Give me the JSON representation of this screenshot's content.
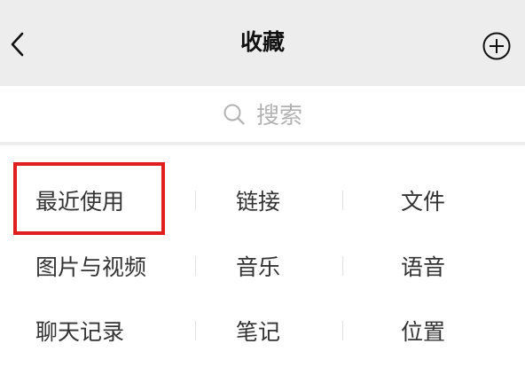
{
  "header": {
    "title": "收藏",
    "back_icon": "chevron-left-icon",
    "add_icon": "plus-circle-icon"
  },
  "search": {
    "placeholder": "搜索",
    "icon": "search-icon"
  },
  "categories": [
    {
      "label": "最近使用",
      "highlighted": true
    },
    {
      "label": "链接"
    },
    {
      "label": "文件"
    },
    {
      "label": "图片与视频"
    },
    {
      "label": "音乐"
    },
    {
      "label": "语音"
    },
    {
      "label": "聊天记录"
    },
    {
      "label": "笔记"
    },
    {
      "label": "位置"
    }
  ],
  "colors": {
    "nav_background": "#ededed",
    "text": "#333333",
    "placeholder": "#b2b2b2",
    "highlight_border": "#e02020"
  }
}
